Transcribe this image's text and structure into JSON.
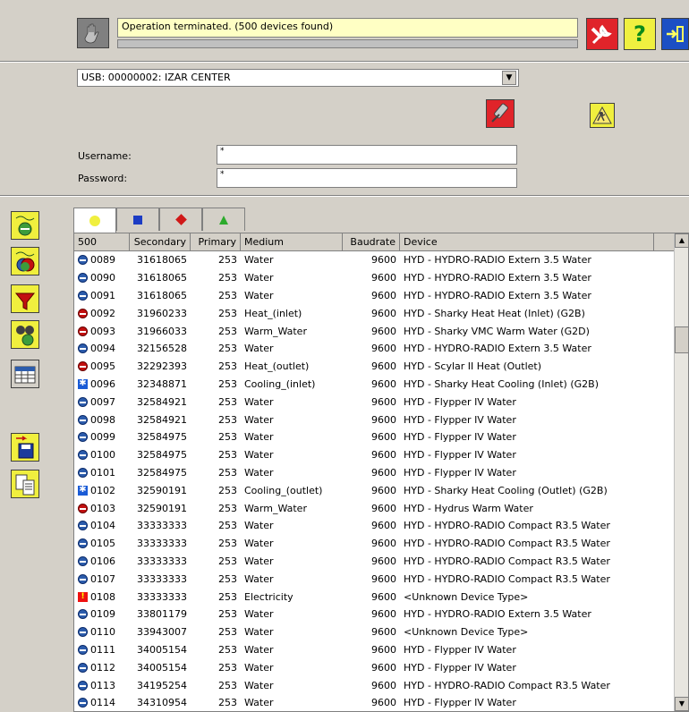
{
  "status": {
    "message": "Operation terminated. (500 devices found)"
  },
  "connection": {
    "selected": "USB: 00000002:  IZAR CENTER"
  },
  "login": {
    "username_label": "Username:",
    "username_value": "*",
    "password_label": "Password:",
    "password_value": "*"
  },
  "table": {
    "headers": [
      "500",
      "Secondary",
      "Primary",
      "Medium",
      "Baudrate",
      "Device"
    ],
    "rows": [
      {
        "icon": "water",
        "id": "0089",
        "secondary": "31618065",
        "primary": "253",
        "medium": "Water",
        "baud": "9600",
        "device": "HYD  -  HYDRO-RADIO Extern 3.5 Water"
      },
      {
        "icon": "water",
        "id": "0090",
        "secondary": "31618065",
        "primary": "253",
        "medium": "Water",
        "baud": "9600",
        "device": "HYD  -  HYDRO-RADIO Extern 3.5 Water"
      },
      {
        "icon": "water",
        "id": "0091",
        "secondary": "31618065",
        "primary": "253",
        "medium": "Water",
        "baud": "9600",
        "device": "HYD  -  HYDRO-RADIO Extern 3.5 Water"
      },
      {
        "icon": "heat",
        "id": "0092",
        "secondary": "31960233",
        "primary": "253",
        "medium": "Heat_(inlet)",
        "baud": "9600",
        "device": "HYD  -  Sharky Heat Heat (Inlet) (G2B)"
      },
      {
        "icon": "heat",
        "id": "0093",
        "secondary": "31966033",
        "primary": "253",
        "medium": "Warm_Water",
        "baud": "9600",
        "device": "HYD  -  Sharky VMC Warm Water (G2D)"
      },
      {
        "icon": "water",
        "id": "0094",
        "secondary": "32156528",
        "primary": "253",
        "medium": "Water",
        "baud": "9600",
        "device": "HYD  -  HYDRO-RADIO Extern 3.5 Water"
      },
      {
        "icon": "heat",
        "id": "0095",
        "secondary": "32292393",
        "primary": "253",
        "medium": "Heat_(outlet)",
        "baud": "9600",
        "device": "HYD  -  Scylar II Heat (Outlet)"
      },
      {
        "icon": "cool",
        "id": "0096",
        "secondary": "32348871",
        "primary": "253",
        "medium": "Cooling_(inlet)",
        "baud": "9600",
        "device": "HYD  -  Sharky Heat Cooling (Inlet) (G2B)"
      },
      {
        "icon": "water",
        "id": "0097",
        "secondary": "32584921",
        "primary": "253",
        "medium": "Water",
        "baud": "9600",
        "device": "HYD  -  Flypper IV Water"
      },
      {
        "icon": "water",
        "id": "0098",
        "secondary": "32584921",
        "primary": "253",
        "medium": "Water",
        "baud": "9600",
        "device": "HYD  -  Flypper IV Water"
      },
      {
        "icon": "water",
        "id": "0099",
        "secondary": "32584975",
        "primary": "253",
        "medium": "Water",
        "baud": "9600",
        "device": "HYD  -  Flypper IV Water"
      },
      {
        "icon": "water",
        "id": "0100",
        "secondary": "32584975",
        "primary": "253",
        "medium": "Water",
        "baud": "9600",
        "device": "HYD  -  Flypper IV Water"
      },
      {
        "icon": "water",
        "id": "0101",
        "secondary": "32584975",
        "primary": "253",
        "medium": "Water",
        "baud": "9600",
        "device": "HYD  -  Flypper IV Water"
      },
      {
        "icon": "cool",
        "id": "0102",
        "secondary": "32590191",
        "primary": "253",
        "medium": "Cooling_(outlet)",
        "baud": "9600",
        "device": "HYD  -  Sharky Heat Cooling (Outlet) (G2B)"
      },
      {
        "icon": "heat",
        "id": "0103",
        "secondary": "32590191",
        "primary": "253",
        "medium": "Warm_Water",
        "baud": "9600",
        "device": "HYD  -  Hydrus Warm Water"
      },
      {
        "icon": "water",
        "id": "0104",
        "secondary": "33333333",
        "primary": "253",
        "medium": "Water",
        "baud": "9600",
        "device": "HYD  -  HYDRO-RADIO Compact R3.5 Water"
      },
      {
        "icon": "water",
        "id": "0105",
        "secondary": "33333333",
        "primary": "253",
        "medium": "Water",
        "baud": "9600",
        "device": "HYD  -  HYDRO-RADIO Compact R3.5 Water"
      },
      {
        "icon": "water",
        "id": "0106",
        "secondary": "33333333",
        "primary": "253",
        "medium": "Water",
        "baud": "9600",
        "device": "HYD  -  HYDRO-RADIO Compact R3.5 Water"
      },
      {
        "icon": "water",
        "id": "0107",
        "secondary": "33333333",
        "primary": "253",
        "medium": "Water",
        "baud": "9600",
        "device": "HYD  -  HYDRO-RADIO Compact R3.5 Water"
      },
      {
        "icon": "elec",
        "id": "0108",
        "secondary": "33333333",
        "primary": "253",
        "medium": "Electricity",
        "baud": "9600",
        "device": "<Unknown Device Type>"
      },
      {
        "icon": "water",
        "id": "0109",
        "secondary": "33801179",
        "primary": "253",
        "medium": "Water",
        "baud": "9600",
        "device": "HYD  -  HYDRO-RADIO Extern 3.5 Water"
      },
      {
        "icon": "water",
        "id": "0110",
        "secondary": "33943007",
        "primary": "253",
        "medium": "Water",
        "baud": "9600",
        "device": "<Unknown Device Type>"
      },
      {
        "icon": "water",
        "id": "0111",
        "secondary": "34005154",
        "primary": "253",
        "medium": "Water",
        "baud": "9600",
        "device": "HYD  -  Flypper IV Water"
      },
      {
        "icon": "water",
        "id": "0112",
        "secondary": "34005154",
        "primary": "253",
        "medium": "Water",
        "baud": "9600",
        "device": "HYD  -  Flypper IV Water"
      },
      {
        "icon": "water",
        "id": "0113",
        "secondary": "34195254",
        "primary": "253",
        "medium": "Water",
        "baud": "9600",
        "device": "HYD  -  HYDRO-RADIO Compact R3.5 Water"
      },
      {
        "icon": "water",
        "id": "0114",
        "secondary": "34310954",
        "primary": "253",
        "medium": "Water",
        "baud": "9600",
        "device": "HYD  -  Flypper IV Water"
      }
    ]
  },
  "icons": {
    "top": [
      "hand-stop-icon",
      "tools-icon",
      "help-icon",
      "exit-icon"
    ],
    "panel": [
      "radio-off-icon",
      "workman-icon"
    ],
    "sidebar": [
      "read-devices-icon",
      "read-all-icon",
      "filter-icon",
      "search-icon",
      "calendar-icon",
      "save-icon",
      "copy-icon"
    ],
    "tabs": [
      "yellow-circle-icon",
      "blue-square-icon",
      "red-diamond-icon",
      "green-triangle-icon"
    ]
  },
  "colors": {
    "background": "#d4d0c8",
    "status_bg": "#ffffc4",
    "accent_red": "#e0242a",
    "accent_yellow": "#f0f040",
    "accent_blue": "#1c4fc4"
  }
}
